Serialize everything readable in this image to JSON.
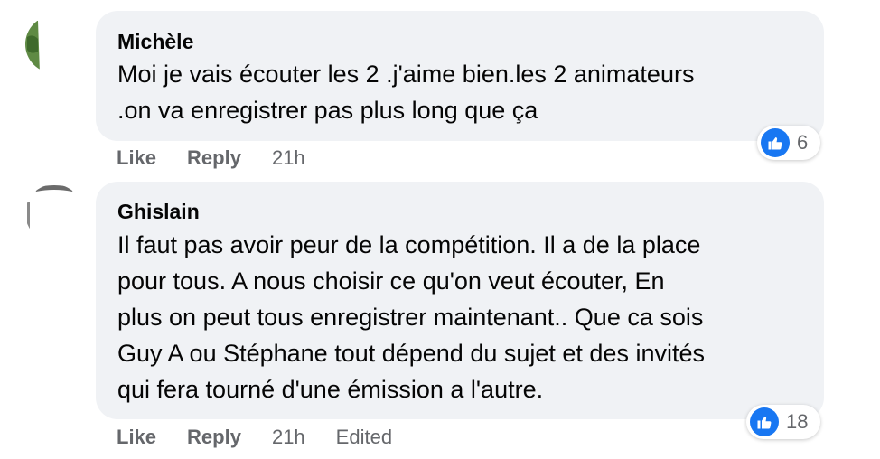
{
  "comments": [
    {
      "author": "Michèle",
      "text": "Moi je vais écouter les 2 .j'aime bien.les 2 animateurs\n.on va enregistrer pas plus long que ça",
      "actions": {
        "like": "Like",
        "reply": "Reply",
        "time": "21h"
      },
      "reaction_count": "6"
    },
    {
      "author": "Ghislain",
      "text": "Il faut pas avoir peur de la compétition. Il a de la place\npour tous. A nous choisir ce qu'on veut écouter, En\nplus on peut tous enregistrer maintenant.. Que ca sois\nGuy A ou Stéphane tout dépend du sujet et des invités\nqui fera tourné d'une émission a l'autre.",
      "actions": {
        "like": "Like",
        "reply": "Reply",
        "time": "21h",
        "edited": "Edited"
      },
      "reaction_count": "18"
    }
  ],
  "colors": {
    "bubble": "#f0f2f5",
    "secondary_text": "#65676b",
    "like_blue": "#1877f2"
  },
  "icons": {
    "reaction": "thumbs-up-icon"
  }
}
